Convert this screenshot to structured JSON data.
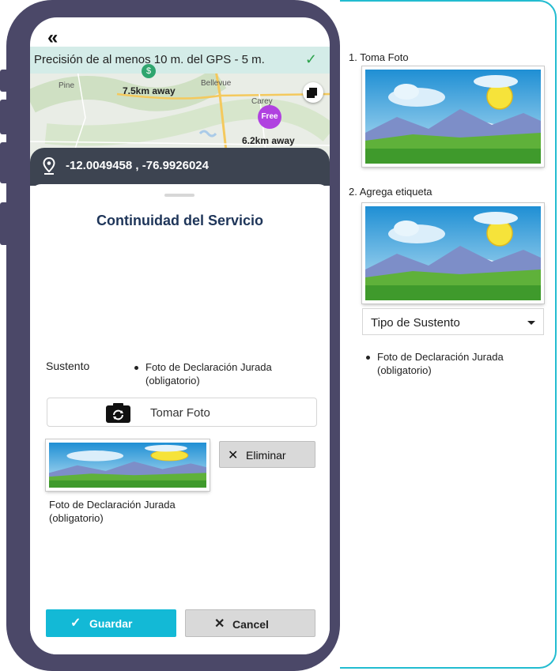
{
  "guide": {
    "step1_label": "1. Toma Foto",
    "step2_label": "2. Agrega etiqueta",
    "select_value": "Tipo de Sustento",
    "bullet_line1": "Foto de Declaración Jurada",
    "bullet_line2": "(obligatorio)"
  },
  "phone": {
    "gps_banner": "Precisión de al menos 10 m. del GPS - 5 m.",
    "map": {
      "town_bellevue": "Bellevue",
      "town_carey": "Carey",
      "town_pine": "Pine",
      "label_near": "7.5km away",
      "label_far": "6.2km away",
      "free_pin": "Free",
      "dollar_pin": "$"
    },
    "coordinates": "-12.0049458 , -76.9926024",
    "form": {
      "title": "Continuidad del Servicio",
      "field_label": "Sustento",
      "bullet_line1": "Foto de Declaración Jurada",
      "bullet_line2": "(obligatorio)",
      "take_photo": "Tomar Foto",
      "delete": "Eliminar",
      "photo_caption_line1": "Foto de Declaración Jurada",
      "photo_caption_line2": "(obligatorio)",
      "save": "Guardar",
      "cancel": "Cancel"
    }
  },
  "colors": {
    "accent": "#13b9d6",
    "title": "#1e3559",
    "phone_frame": "#4b4868",
    "coords_bar": "#3d4451",
    "free_pin": "#b042e0"
  }
}
